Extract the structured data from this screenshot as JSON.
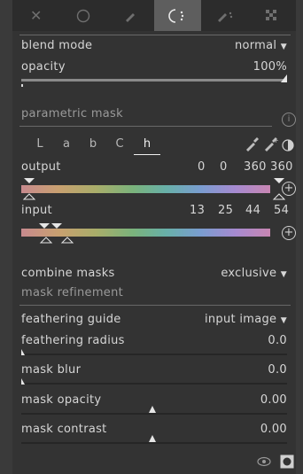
{
  "toolbar": {
    "icons": [
      "close-icon",
      "circle-icon",
      "pencil-icon",
      "parametric-icon",
      "drawn-parametric-icon",
      "raster-icon"
    ],
    "active": "parametric-icon"
  },
  "blend_mode": {
    "label": "blend mode",
    "value": "normal"
  },
  "opacity": {
    "label": "opacity",
    "value": "100%",
    "level": 1.0
  },
  "parametric_mask": {
    "label": "parametric mask",
    "info_icon": "info-icon"
  },
  "channels": {
    "tabs": [
      "L",
      "a",
      "b",
      "C",
      "h"
    ],
    "active": "h"
  },
  "output": {
    "label": "output",
    "values": [
      "0",
      "0",
      "360",
      "360"
    ]
  },
  "input": {
    "label": "input",
    "values": [
      "13",
      "25",
      "44",
      "54"
    ]
  },
  "combine_masks": {
    "label": "combine masks",
    "value": "exclusive"
  },
  "mask_refinement": {
    "label": "mask refinement"
  },
  "feathering_guide": {
    "label": "feathering guide",
    "value": "input image"
  },
  "feathering_radius": {
    "label": "feathering radius",
    "value": "0.0",
    "level": 0.0
  },
  "mask_blur": {
    "label": "mask blur",
    "value": "0.0",
    "level": 0.0
  },
  "mask_opacity": {
    "label": "mask opacity",
    "value": "0.00",
    "level": 0.5
  },
  "mask_contrast": {
    "label": "mask contrast",
    "value": "0.00",
    "level": 0.5
  },
  "colors": {
    "panel": "#333333",
    "toolbar": "#2c2c2c",
    "active_tab": "#5e5e5e",
    "text": "#d6d6d6"
  }
}
